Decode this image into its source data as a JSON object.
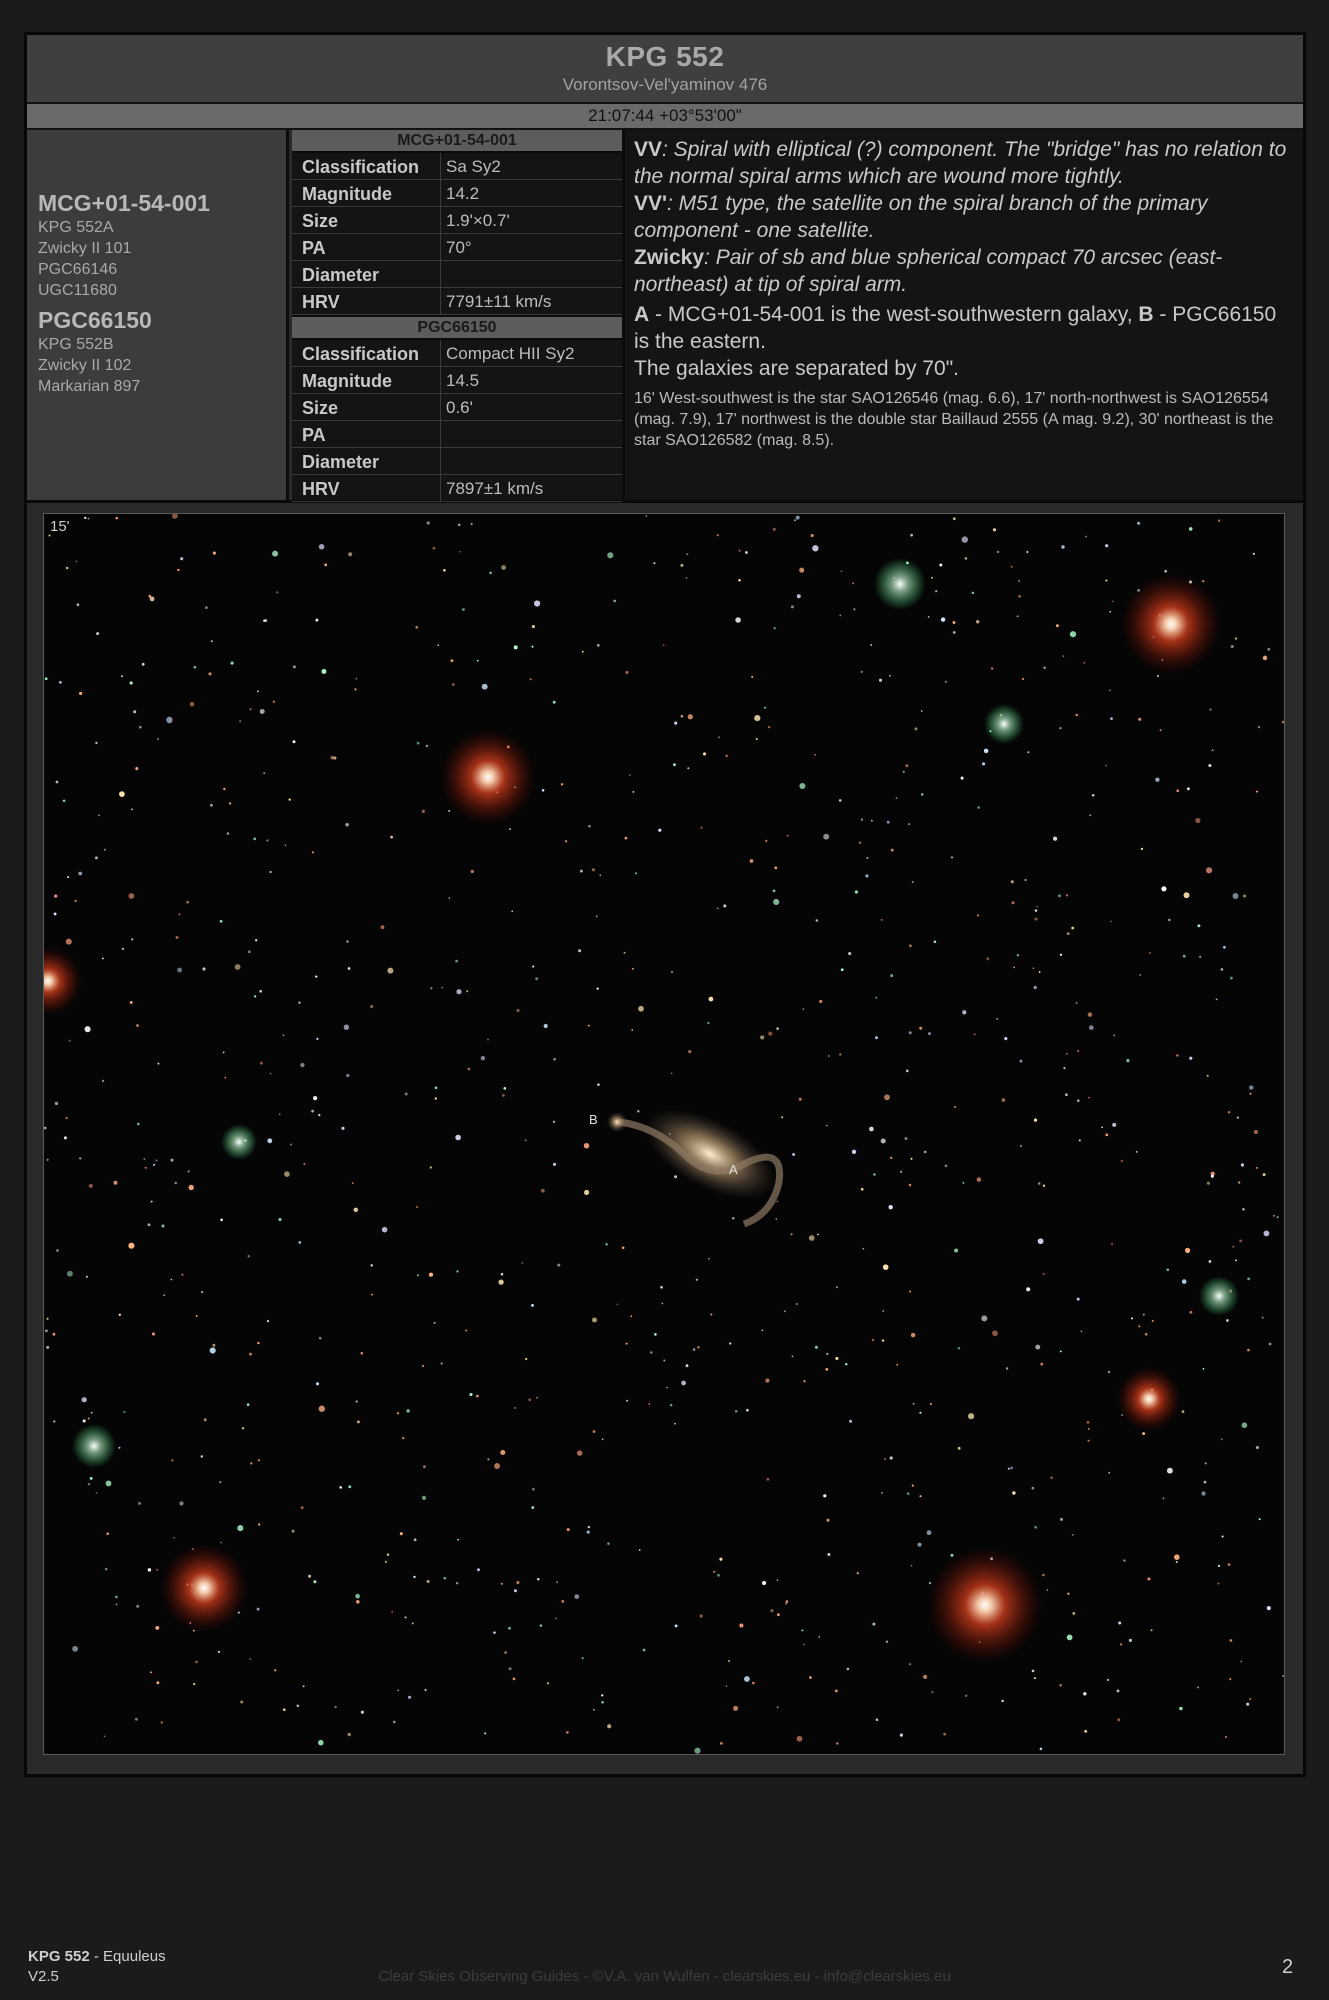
{
  "header": {
    "title": "KPG 552",
    "subtitle": "Vorontsov-Vel'yaminov 476",
    "coordinates": "21:07:44 +03°53'00\""
  },
  "left_panel": {
    "galaxy_a": {
      "name": "MCG+01-54-001",
      "aliases": [
        "KPG 552A",
        "Zwicky II 101",
        "PGC66146",
        "UGC11680"
      ]
    },
    "galaxy_b": {
      "name": "PGC66150",
      "aliases": [
        "KPG 552B",
        "Zwicky II 102",
        "Markarian 897"
      ]
    }
  },
  "tables": [
    {
      "title": "MCG+01-54-001",
      "rows": [
        {
          "key": "Classification",
          "value": "Sa Sy2"
        },
        {
          "key": "Magnitude",
          "value": "14.2"
        },
        {
          "key": "Size",
          "value": "1.9'×0.7'"
        },
        {
          "key": "PA",
          "value": "70°"
        },
        {
          "key": "Diameter",
          "value": ""
        },
        {
          "key": "HRV",
          "value": "7791±11 km/s"
        }
      ]
    },
    {
      "title": "PGC66150",
      "rows": [
        {
          "key": "Classification",
          "value": "Compact HII Sy2"
        },
        {
          "key": "Magnitude",
          "value": "14.5"
        },
        {
          "key": "Size",
          "value": "0.6'"
        },
        {
          "key": "PA",
          "value": ""
        },
        {
          "key": "Diameter",
          "value": ""
        },
        {
          "key": "HRV",
          "value": "7897±1 km/s"
        }
      ]
    }
  ],
  "description": {
    "vv_label": "VV",
    "vv_text": ": Spiral with elliptical (?) component. The \"bridge\" has no relation to the normal spiral arms which are wound more tightly.",
    "vvp_label": "VV'",
    "vvp_text": ": M51 type, the satellite on the spiral branch of the primary component - one satellite.",
    "zwicky_label": "Zwicky",
    "zwicky_text": ": Pair of sb and blue spherical compact 70 arcsec (east-northeast) at tip of spiral arm.",
    "a_label": "A",
    "a_text": " - MCG+01-54-001 is the west-southwestern galaxy, ",
    "b_label": "B",
    "b_text": " - PGC66150 is the eastern.",
    "separation": "The galaxies are separated by 70\".",
    "stars": "16' West-southwest is the star SAO126546 (mag. 6.6), 17' north-northwest is SAO126554 (mag. 7.9), 17' northwest is the double star Baillaud 2555 (A mag. 9.2), 30' northeast is the star SAO126582 (mag. 8.5)."
  },
  "image": {
    "scale_label": "15'",
    "label_a": "A",
    "label_b": "B"
  },
  "footer": {
    "object": "KPG 552",
    "constellation": " - Equuleus",
    "version": "V2.5",
    "credits": "Clear Skies Observing Guides - ©V.A. van Wulfen - clearskies.eu - info@clearskies.eu",
    "page": "2"
  }
}
